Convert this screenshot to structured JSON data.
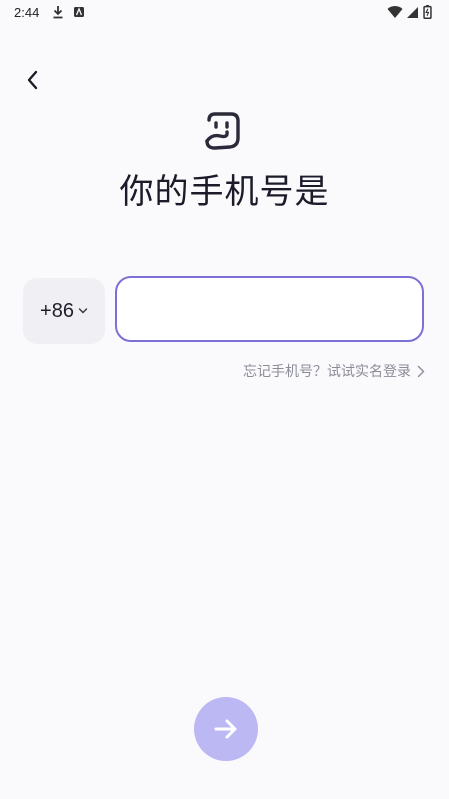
{
  "status_bar": {
    "time": "2:44",
    "icons": [
      "download-icon",
      "notification-app-icon",
      "wifi-icon",
      "cellular-signal-icon",
      "battery-charging-icon"
    ]
  },
  "header": {
    "back_icon": "chevron-left-icon"
  },
  "logo": {
    "icon": "app-logo-icon"
  },
  "title": "你的手机号是",
  "phone": {
    "country_code": "+86",
    "input_value": "",
    "input_placeholder": ""
  },
  "forgot_link": {
    "label": "忘记手机号？试试实名登录"
  },
  "next_button": {
    "icon": "arrow-right-icon"
  },
  "colors": {
    "accent_border": "#7b70d6",
    "next_button_bg": "#bcb8f3",
    "background": "#fafafc"
  }
}
